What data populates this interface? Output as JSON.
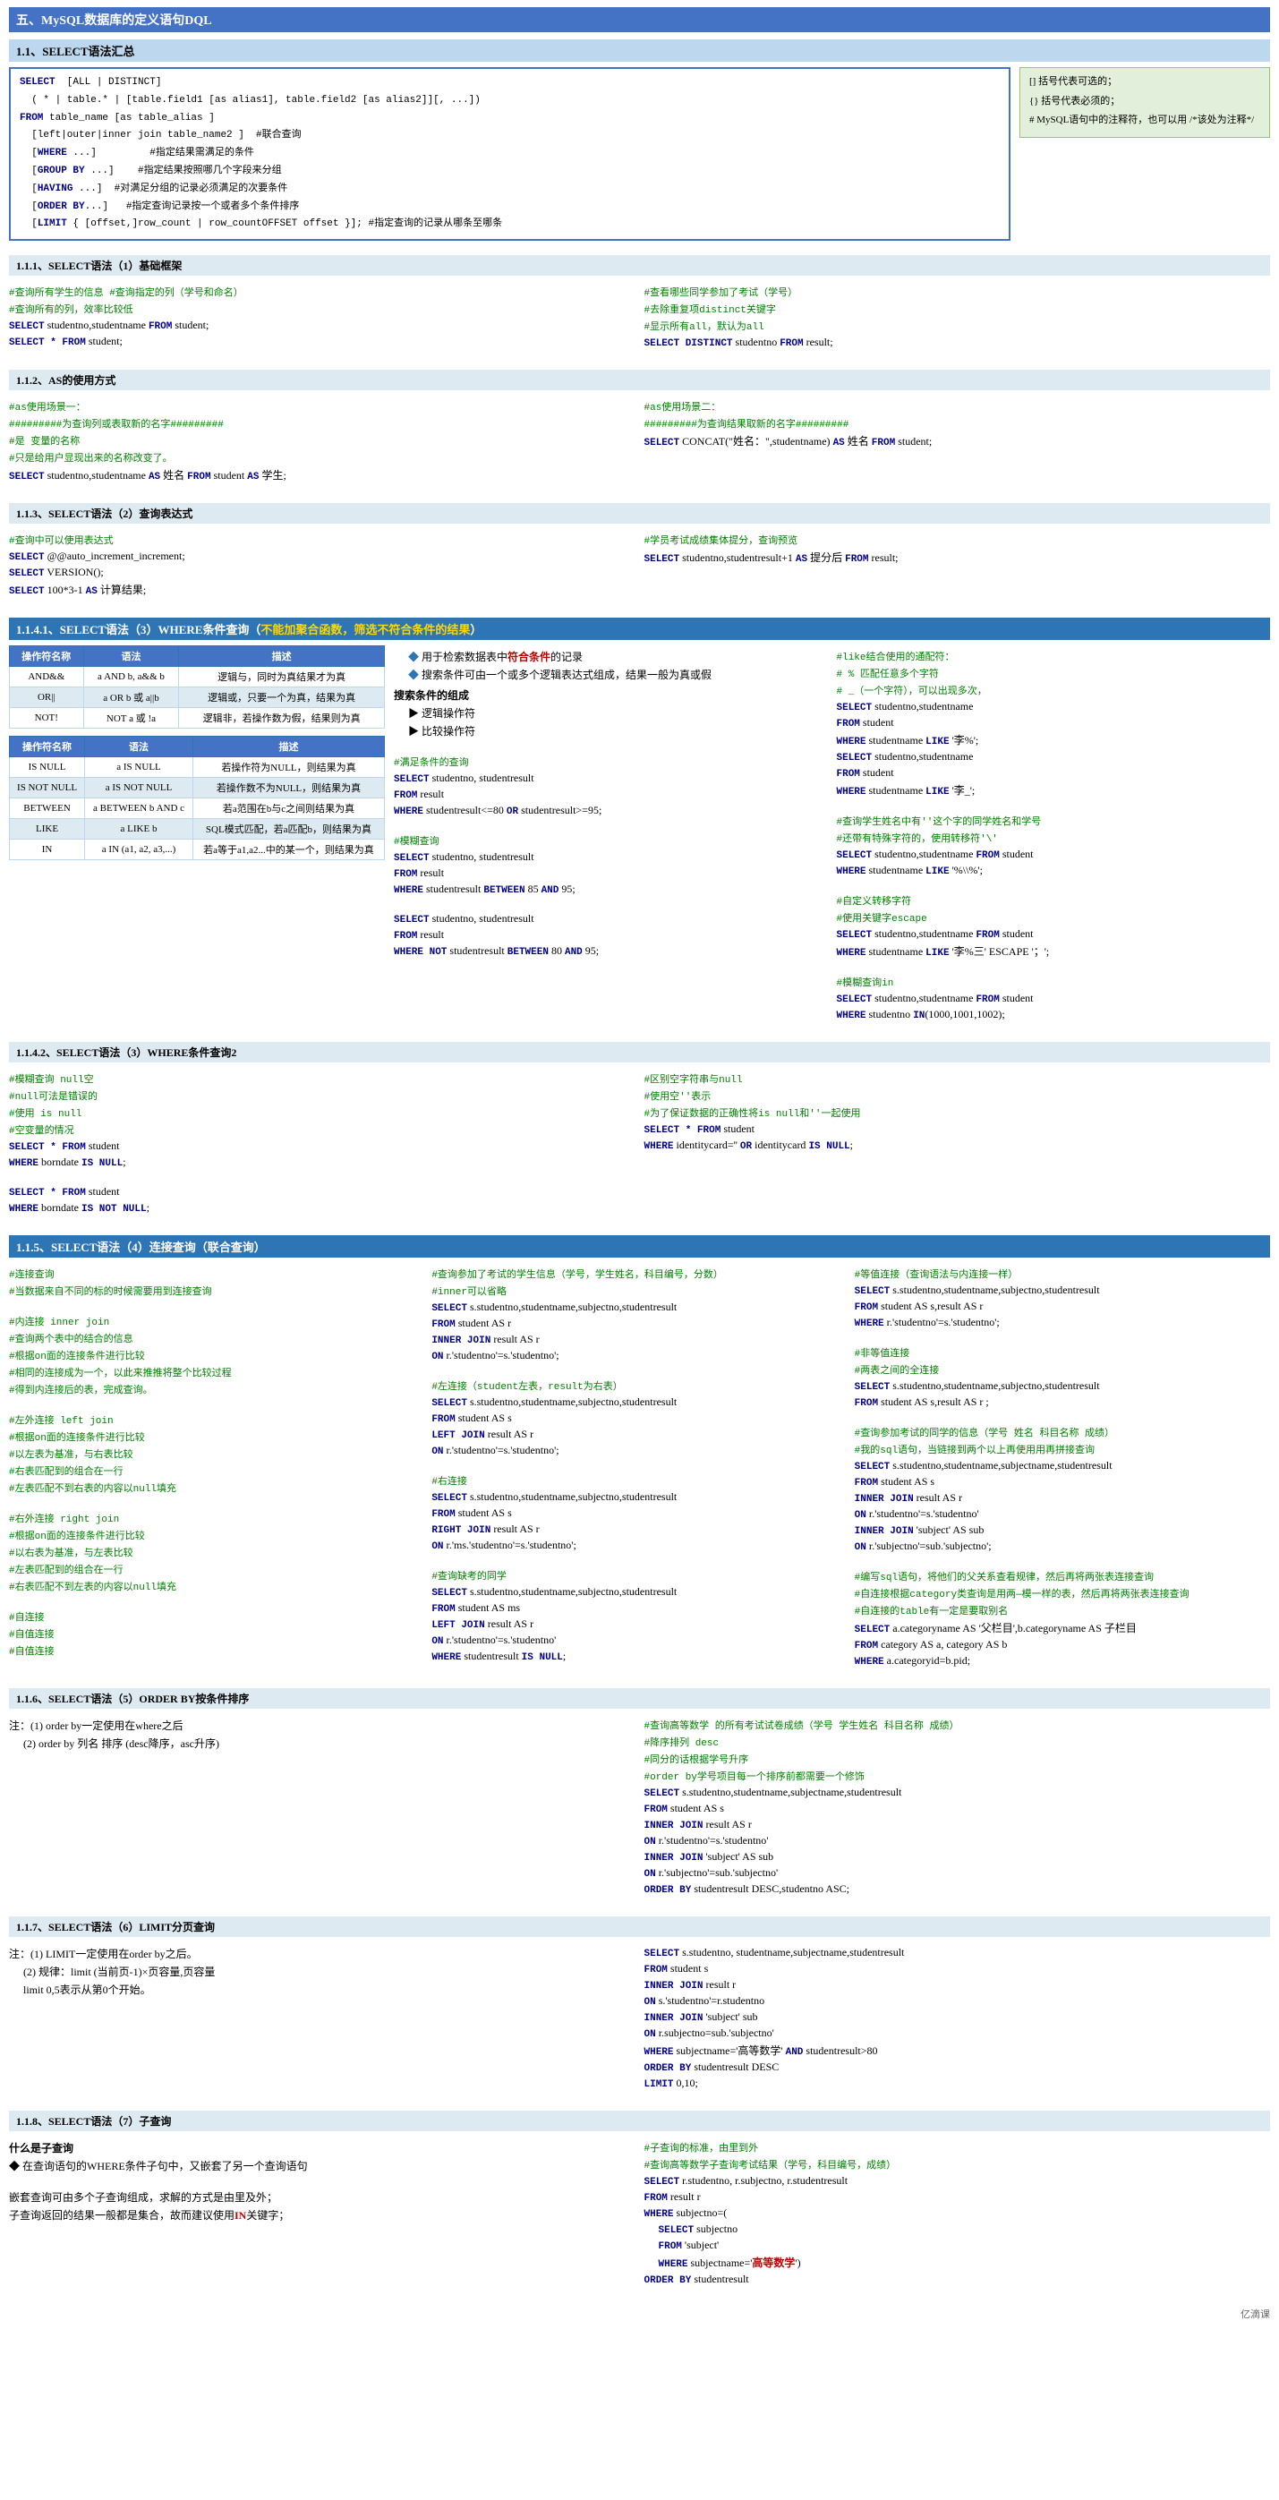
{
  "page": {
    "title": "五、MySQL数据库的定义语句DQL",
    "sections": [
      {
        "id": "s1",
        "title": "1.1、SELECT语法汇总"
      }
    ],
    "footer": "亿滴课"
  }
}
